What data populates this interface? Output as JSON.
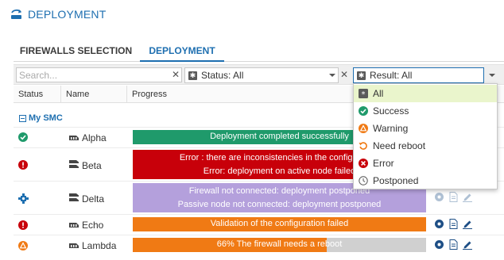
{
  "header": {
    "title": "DEPLOYMENT",
    "icon": "deployment-icon"
  },
  "tabs": [
    {
      "label": "FIREWALLS SELECTION",
      "active": false
    },
    {
      "label": "DEPLOYMENT",
      "active": true
    }
  ],
  "filters": {
    "search_placeholder": "Search...",
    "status_label": "Status: All",
    "result_label": "Result: All"
  },
  "columns": {
    "status": "Status",
    "name": "Name",
    "progress": "Progress"
  },
  "group": {
    "label": "My SMC"
  },
  "rows": [
    {
      "name": "Alpha",
      "status_icon": "success-icon",
      "progress_lines": [
        "Deployment completed successfully",
        ""
      ],
      "progress_percent": 100,
      "color": "#1f9a6b"
    },
    {
      "name": "Beta",
      "status_icon": "error-icon",
      "progress_lines": [
        "Error : there are inconsistencies in the configuration",
        "Error: deployment on active node failed"
      ],
      "progress_percent": 100,
      "color": "#c8000a"
    },
    {
      "name": "Delta",
      "status_icon": "postponed-node-icon",
      "progress_lines": [
        "Firewall not connected: deployment postponed",
        "Passive node not connected: deployment postponed"
      ],
      "progress_percent": 100,
      "color": "#b4a0dc"
    },
    {
      "name": "Echo",
      "status_icon": "error-icon",
      "progress_lines": [
        "Validation of the configuration failed",
        ""
      ],
      "progress_percent": 100,
      "color": "#f07a14"
    },
    {
      "name": "Lambda",
      "status_icon": "warning-icon",
      "progress_lines": [
        "66% The firewall needs a reboot",
        ""
      ],
      "progress_percent": 66,
      "color": "#f07a14"
    }
  ],
  "dropdown": {
    "options": [
      {
        "label": "All",
        "icon": "all-icon",
        "selected": true
      },
      {
        "label": "Success",
        "icon": "success-icon"
      },
      {
        "label": "Warning",
        "icon": "warning-icon"
      },
      {
        "label": "Need reboot",
        "icon": "reboot-icon"
      },
      {
        "label": "Error",
        "icon": "error-icon"
      },
      {
        "label": "Postponed",
        "icon": "clock-icon"
      }
    ]
  },
  "colors": {
    "accent": "#1e6fb0",
    "success": "#1f9a6b",
    "error": "#c8000a",
    "warning": "#f07a14",
    "postponed": "#b4a0dc",
    "selected_option_bg": "#eaf5cc"
  }
}
